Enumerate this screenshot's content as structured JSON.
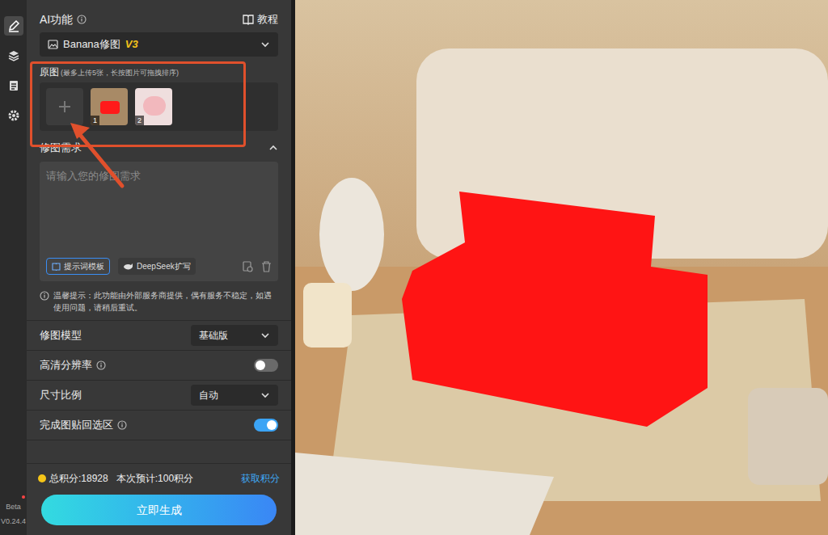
{
  "rail": {
    "items": [
      {
        "kind": "edit",
        "selected": true
      },
      {
        "kind": "layers",
        "selected": false
      },
      {
        "kind": "document",
        "selected": false
      },
      {
        "kind": "settings",
        "selected": false
      }
    ],
    "badge": "Beta",
    "version": "V0.24.4"
  },
  "panel": {
    "title": "AI功能",
    "tutorial": "教程"
  },
  "function_select": {
    "value": "Banana修图",
    "tag": "V3"
  },
  "source": {
    "title": "原图",
    "hint": "(最多上传5张，长按图片可拖拽排序)",
    "images": [
      {
        "number": "1"
      },
      {
        "number": "2"
      }
    ]
  },
  "request": {
    "title": "修图需求",
    "expanded": true,
    "placeholder": "请输入您的修图需求",
    "buttons": [
      "提示词模板",
      "DeepSeek扩写"
    ]
  },
  "notice": "温馨提示：此功能由外部服务商提供，偶有服务不稳定，如遇使用问题，请稍后重试。",
  "settings": [
    {
      "kind": "select",
      "label": "修图模型",
      "info": false,
      "value": "基础版"
    },
    {
      "kind": "toggle",
      "label": "高清分辨率",
      "info": true,
      "on": false
    },
    {
      "kind": "select",
      "label": "尺寸比例",
      "info": false,
      "value": "自动"
    },
    {
      "kind": "toggle",
      "label": "完成图贴回选区",
      "info": true,
      "on": true
    }
  ],
  "footer": {
    "points": "总积分:18928",
    "estimate": "本次预计:100积分",
    "get_points": "获取积分",
    "generate": "立即生成"
  }
}
